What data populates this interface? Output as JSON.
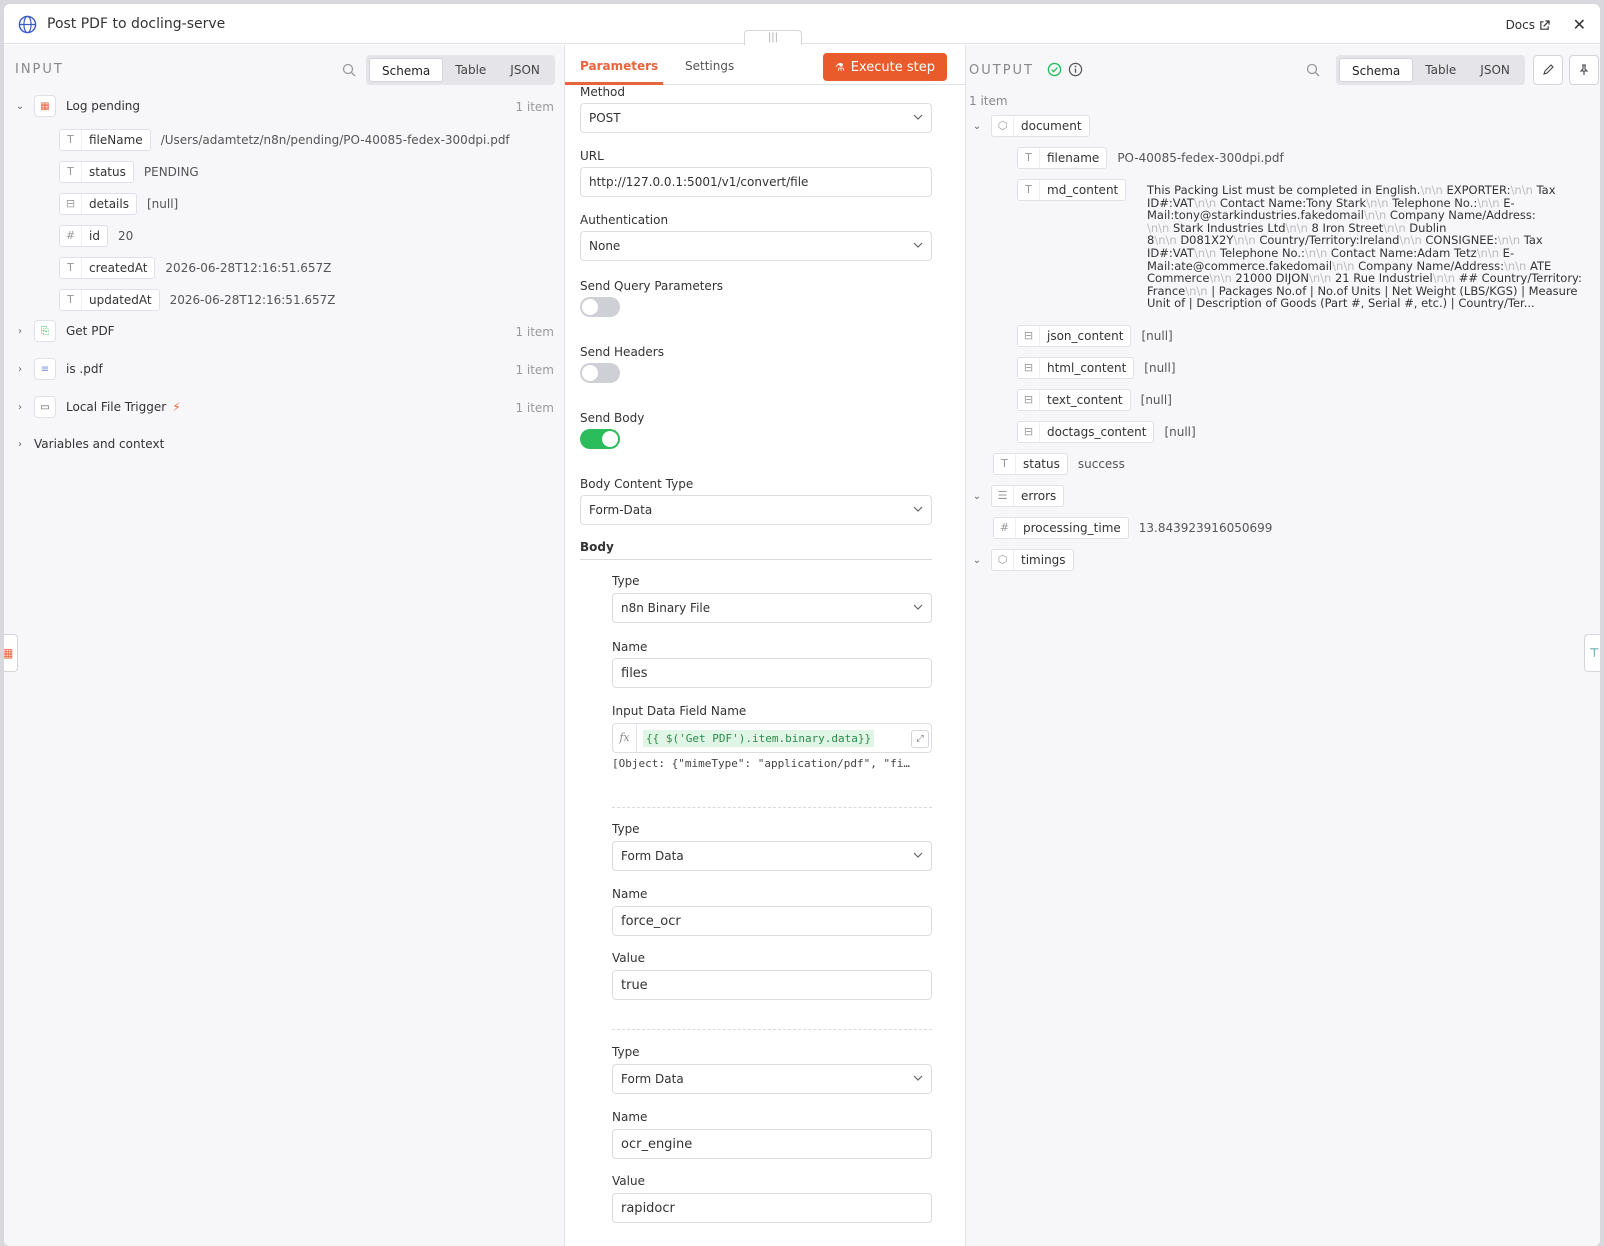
{
  "header": {
    "title": "Post PDF to docling-serve",
    "docs_label": "Docs",
    "drag_label": "|||"
  },
  "input": {
    "title": "INPUT",
    "tabs": [
      "Schema",
      "Table",
      "JSON"
    ],
    "nodes": [
      {
        "label": "Log pending",
        "count": "1 item",
        "icon": "table-icon"
      },
      {
        "label": "Get PDF",
        "count": "1 item",
        "icon": "file-read-icon"
      },
      {
        "label": "is .pdf",
        "count": "1 item",
        "icon": "filter-icon"
      },
      {
        "label": "Local File Trigger",
        "count": "1 item",
        "icon": "folder-icon"
      }
    ],
    "fields": [
      {
        "key": "fileName",
        "value": "/Users/adamtetz/n8n/pending/PO-40085-fedex-300dpi.pdf",
        "type": "T"
      },
      {
        "key": "status",
        "value": "PENDING",
        "type": "T"
      },
      {
        "key": "details",
        "value": "[null]",
        "type": "⊟"
      },
      {
        "key": "id",
        "value": "20",
        "type": "#"
      },
      {
        "key": "createdAt",
        "value": "2026-06-28T12:16:51.657Z",
        "type": "T"
      },
      {
        "key": "updatedAt",
        "value": "2026-06-28T12:16:51.657Z",
        "type": "T"
      }
    ],
    "variables_label": "Variables and context"
  },
  "params": {
    "tabs": [
      "Parameters",
      "Settings"
    ],
    "execute_label": "Execute step",
    "method_label": "Method",
    "method_value": "POST",
    "url_label": "URL",
    "url_value": "http://127.0.0.1:5001/v1/convert/file",
    "auth_label": "Authentication",
    "auth_value": "None",
    "send_query_label": "Send Query Parameters",
    "send_query_on": false,
    "send_headers_label": "Send Headers",
    "send_headers_on": false,
    "send_body_label": "Send Body",
    "send_body_on": true,
    "body_content_type_label": "Body Content Type",
    "body_content_type_value": "Form-Data",
    "body_label": "Body",
    "items": [
      {
        "type_label": "Type",
        "type_value": "n8n Binary File",
        "name_label": "Name",
        "name_value": "files",
        "field_label": "Input Data Field Name",
        "field_expr": "{{ $('Get PDF').item.binary.data}}",
        "field_hint": "[Object: {\"mimeType\": \"application/pdf\", \"fi…"
      },
      {
        "type_label": "Type",
        "type_value": "Form Data",
        "name_label": "Name",
        "name_value": "force_ocr",
        "value_label": "Value",
        "value_value": "true"
      },
      {
        "type_label": "Type",
        "type_value": "Form Data",
        "name_label": "Name",
        "name_value": "ocr_engine",
        "value_label": "Value",
        "value_value": "rapidocr"
      }
    ]
  },
  "output": {
    "title": "OUTPUT",
    "tabs": [
      "Schema",
      "Table",
      "JSON"
    ],
    "item_count": "1 item",
    "document_label": "document",
    "filename_key": "filename",
    "filename_value": "PO-40085-fedex-300dpi.pdf",
    "md_key": "md_content",
    "md_lines": [
      "This Packing List must be completed in English.\\n\\n EXPORTER:\\n\\n Tax",
      "ID#:VAT\\n\\n Contact Name:Tony Stark\\n\\n Telephone No.:\\n\\n E-",
      "Mail:tony@starkindustries.fakedomail\\n\\n Company Name/Address:",
      "\\n\\n Stark Industries Ltd\\n\\n 8 Iron Street\\n\\n Dublin",
      "8\\n\\n D081X2Y\\n\\n Country/Territory:Ireland\\n\\n CONSIGNEE:\\n\\n Tax",
      "ID#:VAT\\n\\n Telephone No.:\\n\\n Contact Name:Adam Tetz\\n\\n E-",
      "Mail:ate@commerce.fakedomail\\n\\n Company Name/Address:\\n\\n ATE",
      "Commerce\\n\\n 21000 DIJON\\n\\n 21 Rue Industriel\\n\\n ## Country/Territory:",
      "France\\n\\n | Packages No.of | No.of Units | Net Weight (LBS/KGS) | Measure",
      "Unit of | Description of Goods (Part #, Serial #, etc.) | Country/Ter..."
    ],
    "null_fields": [
      {
        "key": "json_content",
        "value": "[null]"
      },
      {
        "key": "html_content",
        "value": "[null]"
      },
      {
        "key": "text_content",
        "value": "[null]"
      },
      {
        "key": "doctags_content",
        "value": "[null]"
      }
    ],
    "status_key": "status",
    "status_value": "success",
    "errors_label": "errors",
    "processing_key": "processing_time",
    "processing_value": "13.843923916050699",
    "timings_label": "timings"
  },
  "colors": {
    "accent": "#ea5b2b",
    "success": "#2bbc5c"
  }
}
